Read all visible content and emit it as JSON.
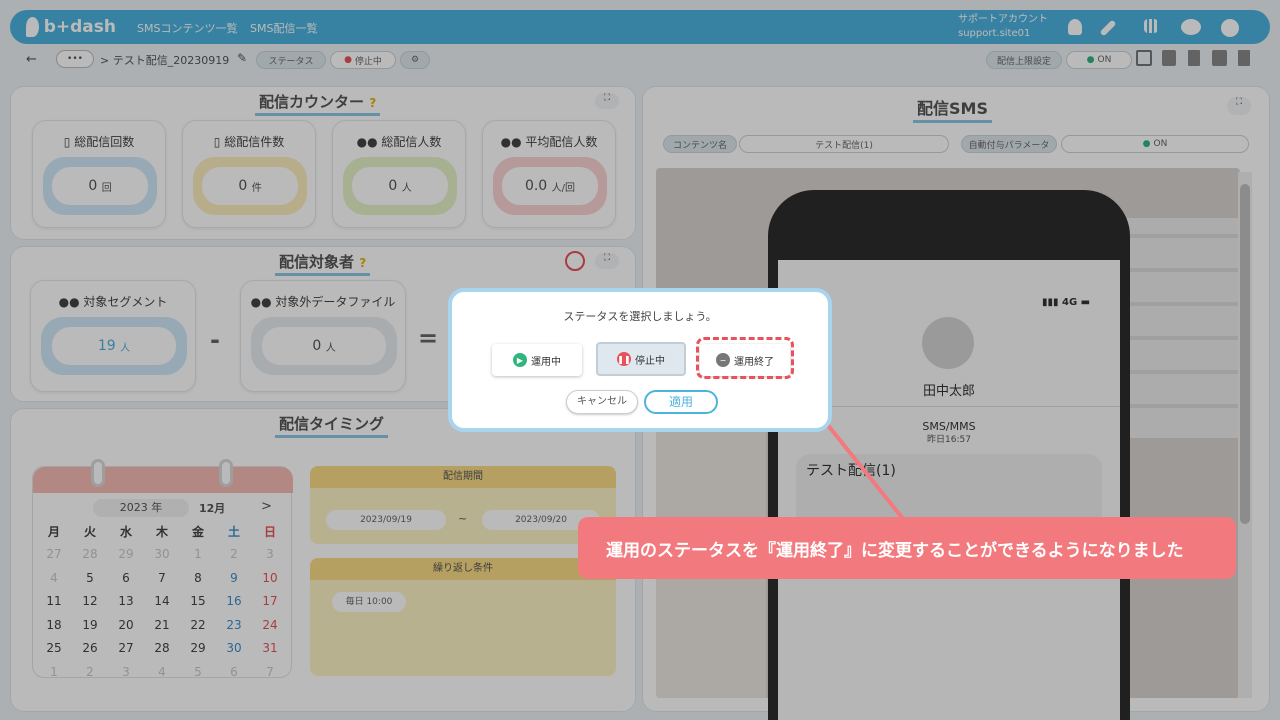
{
  "header": {
    "logo": "b+dash",
    "nav": [
      "SMSコンテンツ一覧",
      "SMS配信一覧"
    ],
    "account_name": "サポートアカウント",
    "account_id": "support.site01",
    "icons": [
      "bell-icon",
      "wrench-icon",
      "grid-icon",
      "chat-icon",
      "logout-icon"
    ]
  },
  "subbar": {
    "more": "•••",
    "breadcrumb": "> テスト配信_20230919",
    "status_label": "ステータス",
    "status_value": "停止中",
    "limit_label": "配信上限設定",
    "limit_value": "ON"
  },
  "counter": {
    "title": "配信カウンター",
    "cards": [
      {
        "label": "総配信回数",
        "num": "0",
        "unit": "回",
        "color": "#cfe8f7"
      },
      {
        "label": "総配信件数",
        "num": "0",
        "unit": "件",
        "color": "#fbeebd"
      },
      {
        "label": "総配信人数",
        "num": "0",
        "unit": "人",
        "color": "#e6f1c9"
      },
      {
        "label": "平均配信人数",
        "num": "0.0",
        "unit": "人/回",
        "color": "#fad3d3"
      }
    ]
  },
  "target": {
    "title": "配信対象者",
    "segment_label": "対象セグメント",
    "segment_num": "19",
    "segment_unit": "人",
    "exclude_label": "対象外データファイル",
    "exclude_num": "0",
    "exclude_unit": "人",
    "minus": "-",
    "equals": "="
  },
  "timing": {
    "title": "配信タイミング",
    "calendar": {
      "year": "2023",
      "year_unit": "年",
      "month": "12月",
      "next": ">",
      "weekdays": [
        "月",
        "火",
        "水",
        "木",
        "金",
        "土",
        "日"
      ],
      "rows": [
        [
          "27",
          "28",
          "29",
          "30",
          "1",
          "2",
          "3"
        ],
        [
          "4",
          "5",
          "6",
          "7",
          "8",
          "9",
          "10"
        ],
        [
          "11",
          "12",
          "13",
          "14",
          "15",
          "16",
          "17"
        ],
        [
          "18",
          "19",
          "20",
          "21",
          "22",
          "23",
          "24"
        ],
        [
          "25",
          "26",
          "27",
          "28",
          "29",
          "30",
          "31"
        ],
        [
          "1",
          "2",
          "3",
          "4",
          "5",
          "6",
          "7"
        ]
      ]
    },
    "period_label": "配信期間",
    "start_date": "2023/09/19",
    "tilde": "~",
    "end_date": "2023/09/20",
    "repeat_label": "繰り返し条件",
    "repeat_value": "毎日 10:00"
  },
  "sms": {
    "title": "配信SMS",
    "content_label": "コンテンツ名",
    "content_value": "テスト配信(1)",
    "param_label": "自動付与パラメータ",
    "param_value": "ON",
    "phone": {
      "signal": "4G",
      "name": "田中太郎",
      "type": "SMS/MMS",
      "time": "昨日16:57",
      "message": "テスト配信(1)"
    }
  },
  "modal": {
    "prompt": "ステータスを選択しましょう。",
    "options": [
      {
        "label": "運用中",
        "icon": "play-icon",
        "color": "#2fb67e"
      },
      {
        "label": "停止中",
        "icon": "pause-icon",
        "color": "#e8525c"
      },
      {
        "label": "運用終了",
        "icon": "minus-icon",
        "color": "#777777"
      }
    ],
    "cancel": "キャンセル",
    "apply": "適用"
  },
  "callout": "運用のステータスを『運用終了』に変更することができるようになりました",
  "colors": {
    "header": "#4cb3de",
    "callout": "#f27a7e",
    "highlight": "#e8525c"
  }
}
